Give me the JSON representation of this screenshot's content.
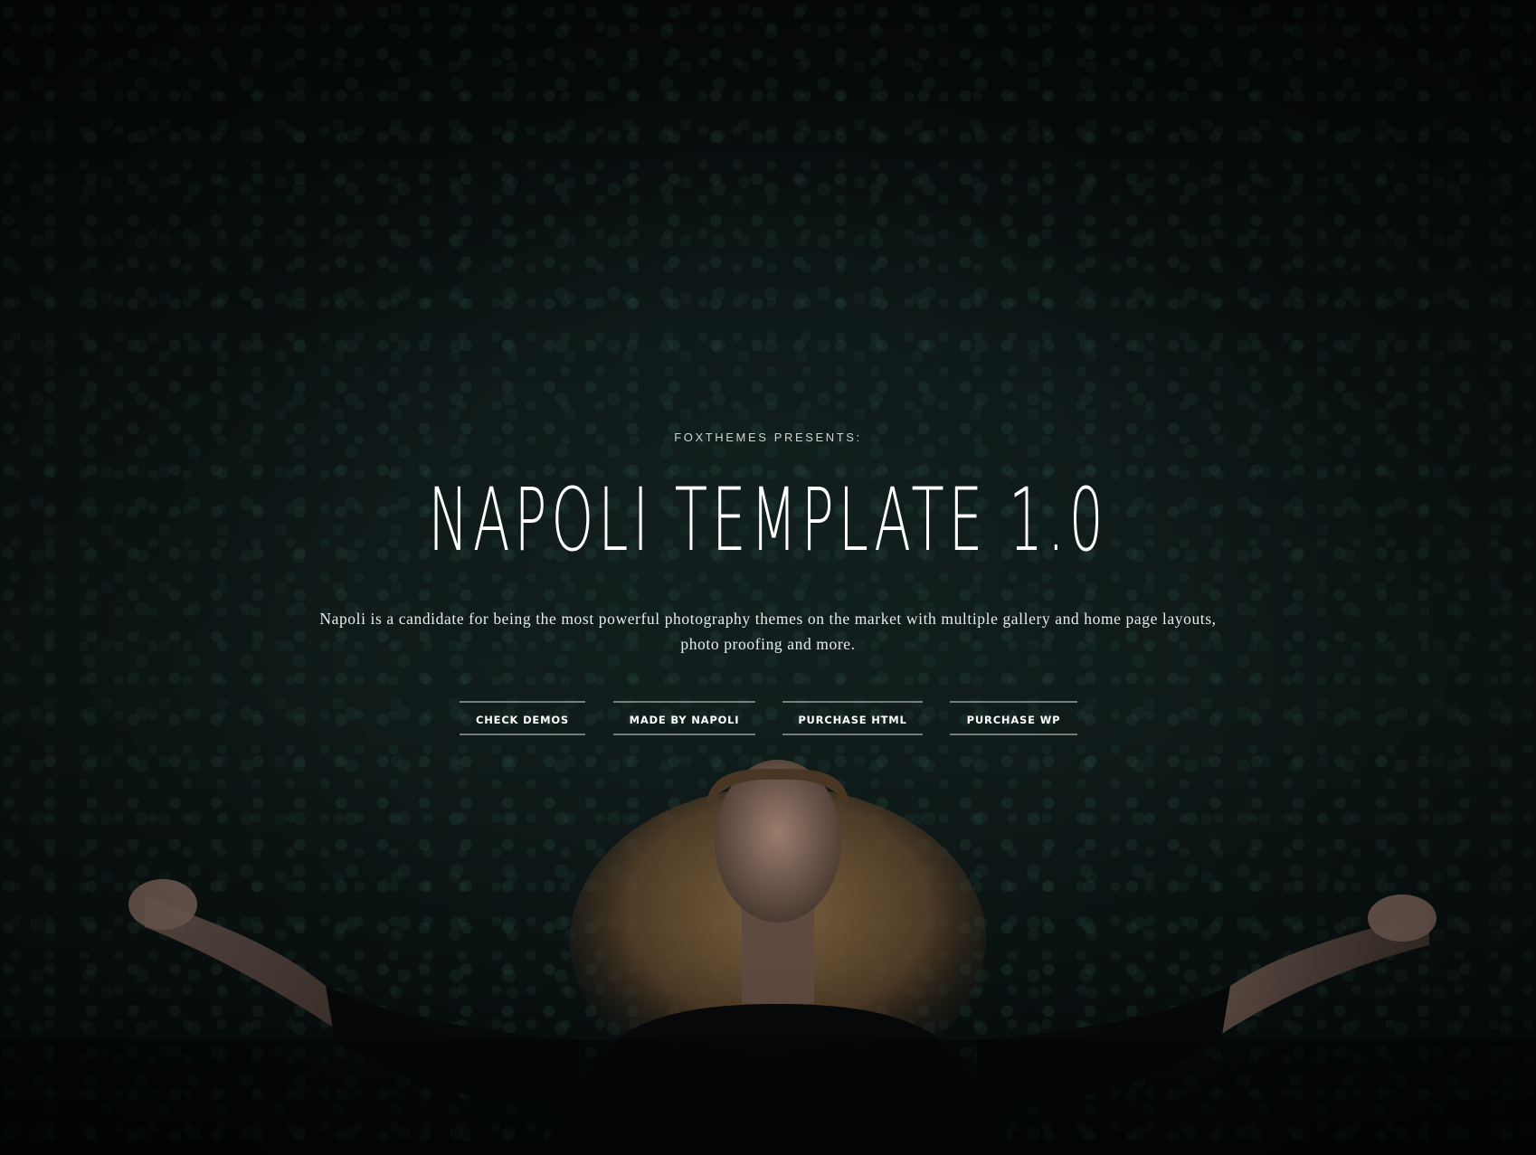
{
  "hero": {
    "eyebrow": "FOXTHEMES PRESENTS:",
    "title": "NAPOLI TEMPLATE 1.0",
    "description": "Napoli is a candidate for being the most powerful photography themes on the market with multiple gallery and home page layouts, photo proofing and more.",
    "buttons": [
      {
        "label": "CHECK DEMOS"
      },
      {
        "label": "MADE BY NAPOLI"
      },
      {
        "label": "PURCHASE HTML"
      },
      {
        "label": "PURCHASE WP"
      }
    ]
  },
  "colors": {
    "background": "#0d1616",
    "text": "#ffffff",
    "button_border": "#c8cdcd"
  }
}
